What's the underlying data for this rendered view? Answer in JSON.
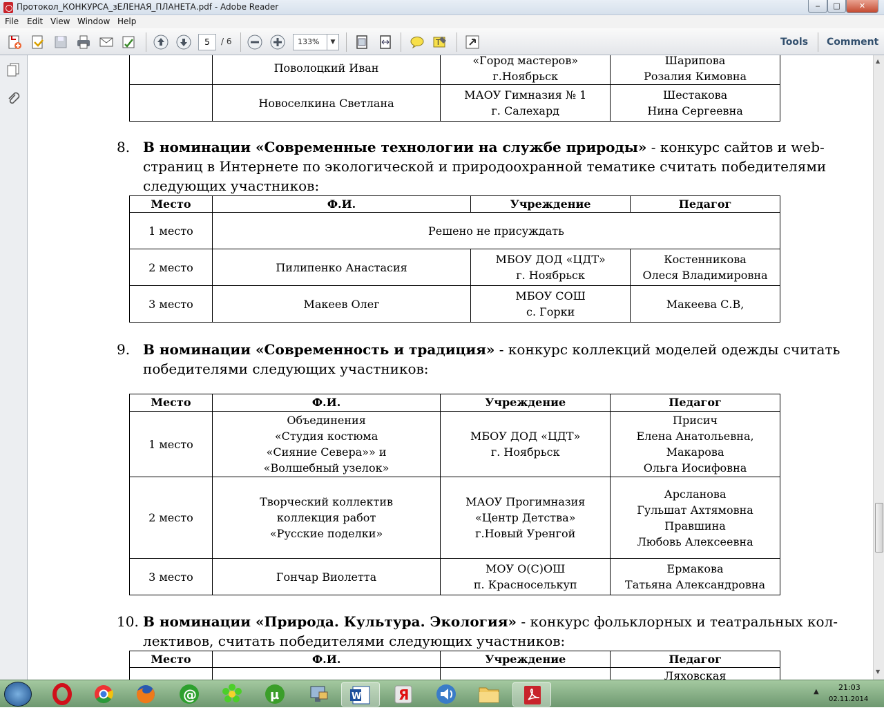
{
  "window": {
    "title": "Протокол_КОНКУРСА_зЕЛЕНАЯ_ПЛАНЕТА.pdf - Adobe Reader",
    "min": "‒",
    "max": "□",
    "close": "✕"
  },
  "menu": [
    "File",
    "Edit",
    "View",
    "Window",
    "Help"
  ],
  "toolbar": {
    "page_current": "5",
    "page_total": "/ 6",
    "zoom": "133%",
    "tools_label": "Tools",
    "comment_label": "Comment"
  },
  "document": {
    "table7_tail": {
      "rows": [
        {
          "place": "",
          "name": "Поволоцкий Иван",
          "inst": [
            "«Город мастеров»",
            "г.Ноябрьск"
          ],
          "teacher": [
            "Шарипова",
            "Розалия Кимовна"
          ]
        },
        {
          "place": "",
          "name": "Новоселкина Светлана",
          "inst": [
            "МАОУ Гимназия № 1",
            "г. Салехард"
          ],
          "teacher": [
            "Шестакова",
            "Нина Сергеевна"
          ]
        }
      ]
    },
    "section8": {
      "num": "8.",
      "bold": "В номинации «Современные технологии на службе природы»",
      "line1_rest": " - конкурс сайтов и web-",
      "line2": "страниц в Интернете по экологической и природоохранной тематике считать победителями",
      "line3": "следующих участников:"
    },
    "table8": {
      "headers": [
        "Место",
        "Ф.И.",
        "Учреждение",
        "Педагог"
      ],
      "row1": {
        "place": "1 место",
        "merged": "Решено не присуждать"
      },
      "row2": {
        "place": "2 место",
        "name": "Пилипенко Анастасия",
        "inst": [
          "МБОУ ДОД «ЦДТ»",
          "г. Ноябрьск"
        ],
        "teacher": [
          "Костенникова",
          "Олеся Владимировна"
        ]
      },
      "row3": {
        "place": "3 место",
        "name": "Макеев Олег",
        "inst": [
          "МБОУ СОШ",
          "с. Горки"
        ],
        "teacher": "Макеева С.В,"
      }
    },
    "section9": {
      "num": "9.",
      "bold": "В номинации «Современность и традиция»",
      "line1_rest": " - конкурс коллекций моделей одежды считать",
      "line2": "победителями следующих участников:"
    },
    "table9": {
      "headers": [
        "Место",
        "Ф.И.",
        "Учреждение",
        "Педагог"
      ],
      "rows": [
        {
          "place": "1 место",
          "name": [
            "Объединения",
            "«Студия костюма",
            "«Сияние Севера»» и",
            "«Волшебный узелок»"
          ],
          "inst": [
            "МБОУ ДОД «ЦДТ»",
            "г. Ноябрьск"
          ],
          "teacher": [
            "Присич",
            "Елена Анатольевна,",
            "Макарова",
            "Ольга Иосифовна"
          ]
        },
        {
          "place": "2 место",
          "name": [
            "Творческий коллектив",
            "коллекция работ",
            "«Русские поделки»"
          ],
          "inst": [
            "МАОУ Прогимназия",
            "«Центр Детства»",
            "г.Новый Уренгой"
          ],
          "teacher": [
            "Арсланова",
            "Гульшат Ахтямовна",
            "Правшина",
            "Любовь Алексеевна"
          ]
        },
        {
          "place": "3 место",
          "name": [
            "Гончар Виолетта"
          ],
          "inst": [
            "МОУ О(С)ОШ",
            "п. Красноселькуп"
          ],
          "teacher": [
            "Ермакова",
            "Татьяна Александровна"
          ]
        }
      ]
    },
    "section10": {
      "num": "10.",
      "bold": "В номинации «Природа. Культура. Экология»",
      "line1_rest": " - конкурс фольклорных и театральных кол-",
      "line2": "лективов, считать победителями следующих участников:"
    },
    "table10": {
      "headers": [
        "Место",
        "Ф.И.",
        "Учреждение",
        "Педагог"
      ],
      "partial_teacher": "Ляховская"
    }
  },
  "taskbar": {
    "time": "21:03",
    "date": "02.11.2014",
    "tray_arrow": "▲"
  }
}
